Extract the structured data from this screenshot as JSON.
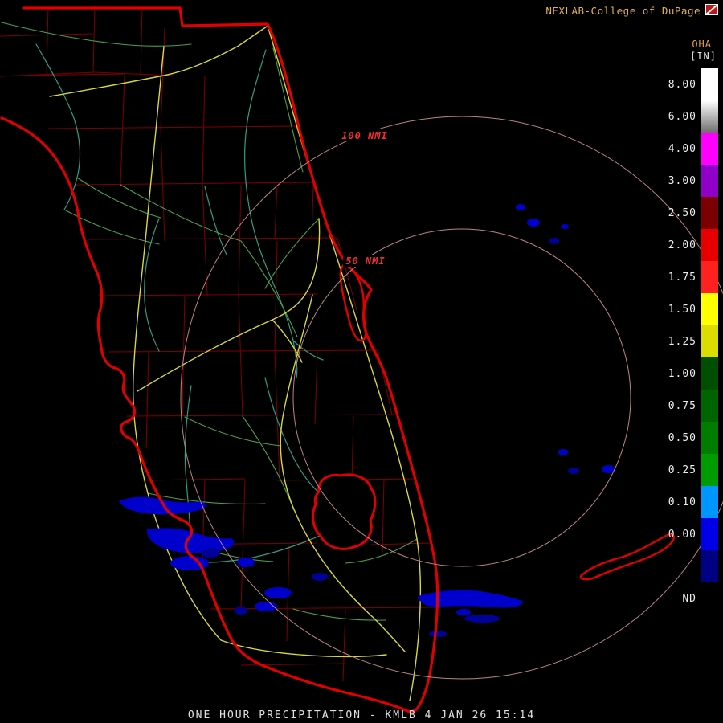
{
  "header": {
    "brand": "NEXLAB-College of DuPage",
    "brand_color": "#E3B24B",
    "logo_icon": "cod-logo"
  },
  "legend": {
    "product_code": "OHA",
    "units": "[IN]",
    "entries": [
      {
        "label": "8.00",
        "color": "#FFFFFF"
      },
      {
        "label": "6.00",
        "color": "#FFFFFF",
        "color2": "#6E6E6E"
      },
      {
        "label": "4.00",
        "color": "#FF00FF"
      },
      {
        "label": "3.00",
        "color": "#9000C8"
      },
      {
        "label": "2.50",
        "color": "#7D0000"
      },
      {
        "label": "2.00",
        "color": "#E60000"
      },
      {
        "label": "1.75",
        "color": "#FF2020"
      },
      {
        "label": "1.50",
        "color": "#FFFF00"
      },
      {
        "label": "1.25",
        "color": "#DCDC00"
      },
      {
        "label": "1.00",
        "color": "#004F00"
      },
      {
        "label": "0.75",
        "color": "#006400"
      },
      {
        "label": "0.50",
        "color": "#007D00"
      },
      {
        "label": "0.25",
        "color": "#009B00"
      },
      {
        "label": "0.10",
        "color": "#0096FF"
      },
      {
        "label": "0.00",
        "color": "#0000E6"
      },
      {
        "label": "",
        "color": "#000082"
      },
      {
        "label": "ND",
        "color": "#000000"
      }
    ]
  },
  "map": {
    "station": "KMLB",
    "range_rings": [
      {
        "label": "100 NMI",
        "radius_nmi": 100
      },
      {
        "label": "50 NMI",
        "radius_nmi": 50
      }
    ],
    "colors": {
      "coastline": "#E00000",
      "county_border": "#7C0000",
      "highway": "#D8D83C",
      "river": "#2E9E86",
      "minor_road": "#49A049",
      "precip_light": "#0000CD",
      "precip_trace": "#00009A",
      "range_ring": "#BE8484",
      "ring_label": "#F03030"
    }
  },
  "footer": {
    "caption": "ONE HOUR PRECIPITATION - KMLB 4 JAN 26 15:14"
  }
}
